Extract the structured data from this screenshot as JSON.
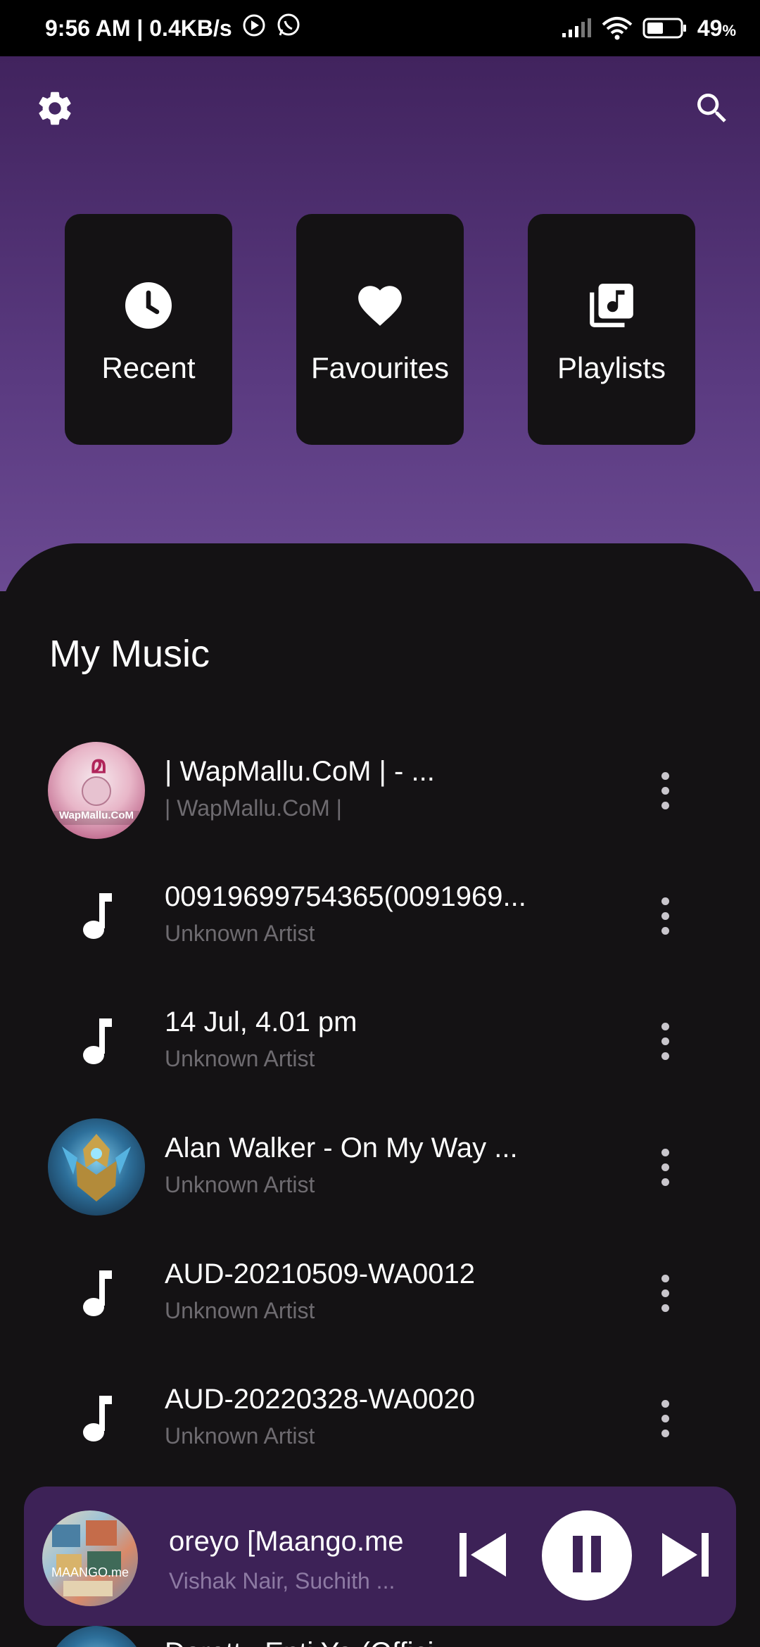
{
  "status_bar": {
    "time_speed": "9:56 AM | 0.4KB/s",
    "battery": "49",
    "battery_unit": "%"
  },
  "header": {
    "settings_icon": "gear-icon",
    "search_icon": "search-icon"
  },
  "categories": [
    {
      "label": "Recent",
      "icon": "clock-icon"
    },
    {
      "label": "Favourites",
      "icon": "heart-icon"
    },
    {
      "label": "Playlists",
      "icon": "library-music-icon"
    }
  ],
  "section_title": "My Music",
  "songs": [
    {
      "title": "| WapMallu.CoM | - ...",
      "artist": "| WapMallu.CoM |",
      "thumb": "album-art",
      "art_text": "WapMallu.CoM"
    },
    {
      "title": "00919699754365(0091969...",
      "artist": "Unknown Artist",
      "thumb": "music-note-icon"
    },
    {
      "title": "14 Jul, 4.01 pm",
      "artist": "Unknown Artist",
      "thumb": "music-note-icon"
    },
    {
      "title": "Alan Walker - On My Way ...",
      "artist": "Unknown Artist",
      "thumb": "album-art"
    },
    {
      "title": "AUD-20210509-WA0012",
      "artist": "Unknown Artist",
      "thumb": "music-note-icon"
    },
    {
      "title": "AUD-20220328-WA0020",
      "artist": "Unknown Artist",
      "thumb": "music-note-icon"
    }
  ],
  "now_playing": {
    "title": "oreyo [Maango.me",
    "artist": "Vishak Nair, Suchith ...",
    "art_text": "MAANGO.me",
    "state": "playing"
  },
  "peek_title": "Dorettu Enti Ya (Offici..."
}
